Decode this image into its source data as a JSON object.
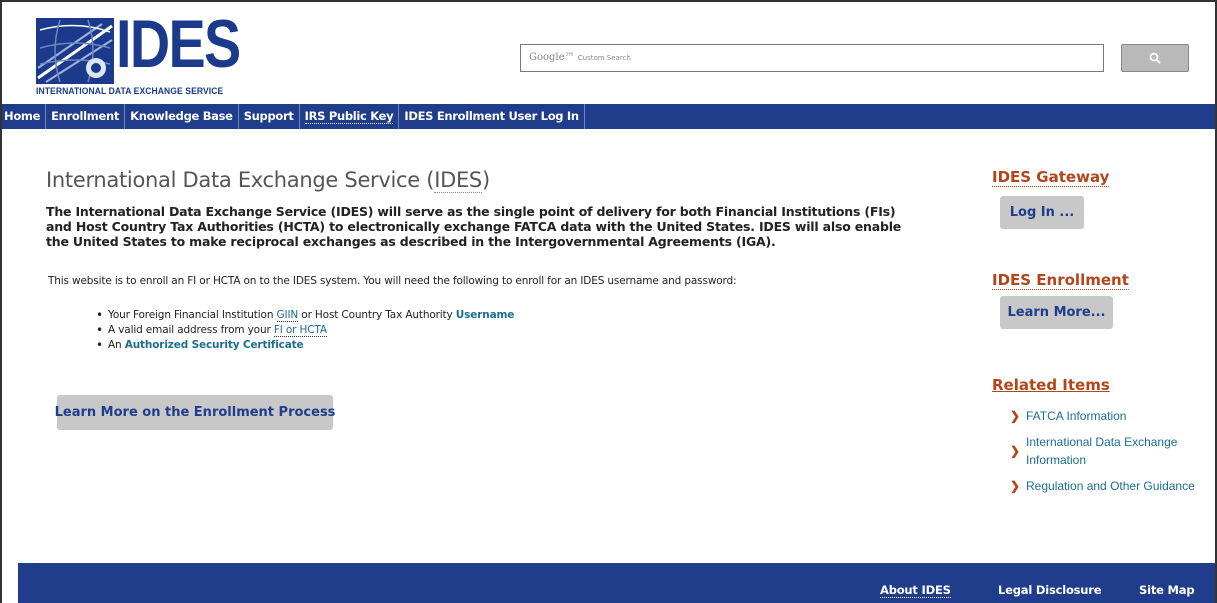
{
  "logo": {
    "wordmark": "IDES",
    "subtitle": "INTERNATIONAL DATA EXCHANGE SERVICE"
  },
  "search": {
    "brand": "Google™",
    "placeholder": "Custom Search"
  },
  "nav": {
    "items": [
      "Home",
      "Enrollment",
      "Knowledge Base",
      "Support",
      "IRS Public Key",
      "IDES Enrollment User Log In"
    ]
  },
  "main": {
    "title_prefix": "International Data Exchange Service (",
    "title_abbr": "IDES",
    "title_suffix": ")",
    "intro": "The International Data Exchange Service (IDES) will serve as the single point of delivery for both Financial Institutions (FIs) and Host Country Tax Authorities (HCTA) to electronically exchange FATCA data with the United States. IDES will also enable the United States to make reciprocal exchanges as described in the Intergovernmental Agreements (IGA).",
    "enroll_note": "This website is to enroll an FI or HCTA on to the IDES system. You will need the following to enroll for an IDES username and password:",
    "bullets": {
      "b1_pre": "Your Foreign Financial Institution ",
      "b1_link1": "GIIN",
      "b1_mid": " or Host Country Tax Authority ",
      "b1_link2": "Username",
      "b2_pre": "A valid email address from your ",
      "b2_link": "FI or HCTA",
      "b3_pre": "An ",
      "b3_link": "Authorized Security Certificate"
    },
    "learn_process_button": "Learn More on the Enrollment Process"
  },
  "sidebar": {
    "gateway_title": "IDES Gateway",
    "login_button": "Log In ...",
    "enrollment_title": "IDES Enrollment",
    "learn_more_button": "Learn More...",
    "related_title": "Related Items",
    "related": [
      "FATCA Information",
      "International Data Exchange Information",
      "Regulation and Other Guidance"
    ]
  },
  "footer": {
    "about": "About IDES",
    "legal": "Legal Disclosure",
    "sitemap": "Site Map"
  },
  "colors": {
    "nav_blue": "#1f3d8b",
    "accent_rust": "#b2461a",
    "link_teal": "#1a6f91",
    "button_grey": "#c8c8c8"
  }
}
